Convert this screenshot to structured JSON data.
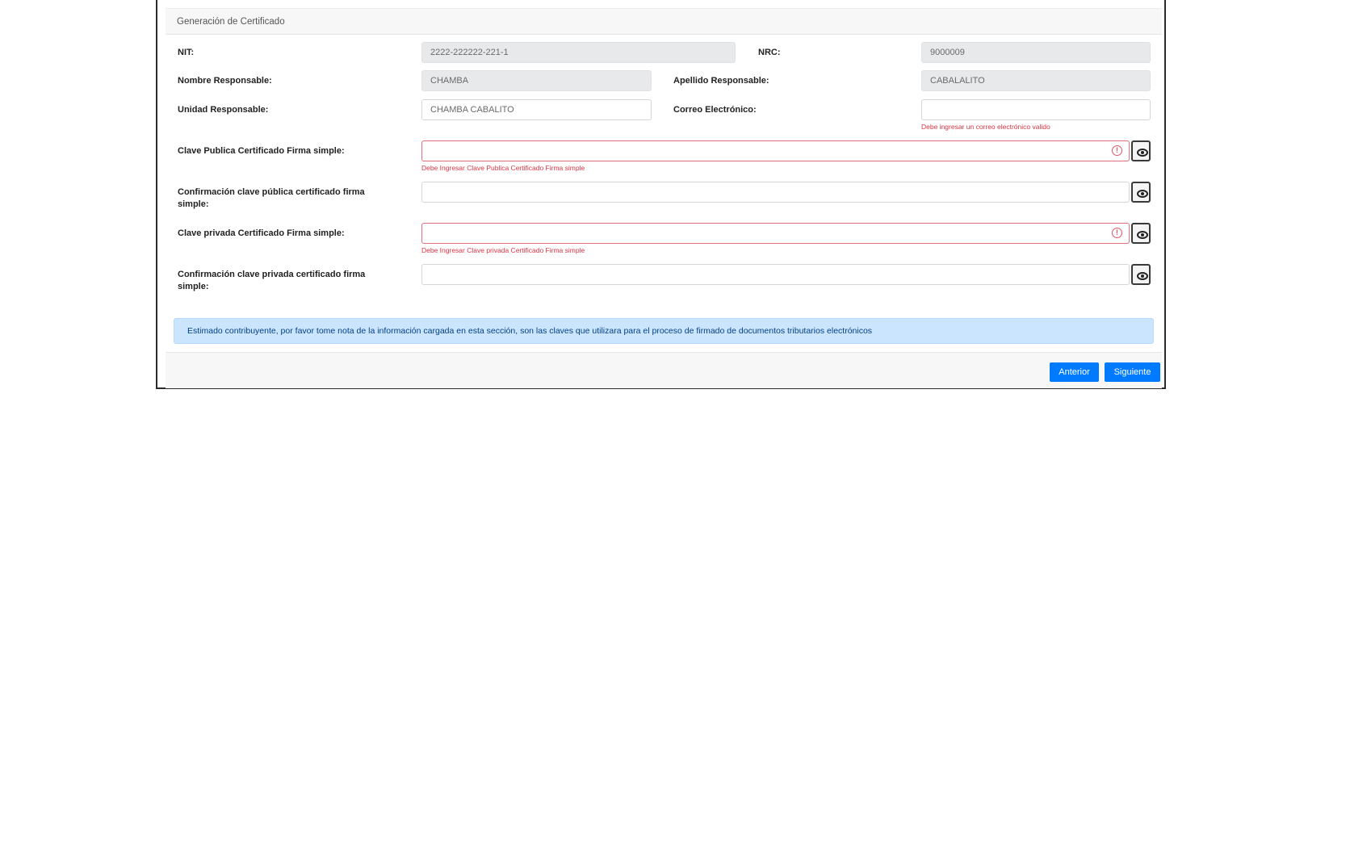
{
  "card": {
    "header_title": "Generación de Certificado"
  },
  "form": {
    "nit": {
      "label": "NIT:",
      "value": "2222-222222-221-1"
    },
    "nrc": {
      "label": "NRC:",
      "value": "9000009"
    },
    "nombre_responsable": {
      "label": "Nombre Responsable:",
      "value": "CHAMBA"
    },
    "apellido_responsable": {
      "label": "Apellido Responsable:",
      "value": "CABALALITO"
    },
    "unidad_responsable": {
      "label": "Unidad Responsable:",
      "value": "CHAMBA CABALITO"
    },
    "correo": {
      "label": "Correo Electrónico:",
      "value": "",
      "error": "Debe ingresar un correo electrónico valido"
    },
    "clave_publica": {
      "label": "Clave Publica Certificado Firma simple:",
      "value": "",
      "error": "Debe Ingresar Clave Publica Certificado Firma simple"
    },
    "confirm_publica": {
      "label": "Confirmación clave pública certificado firma simple:",
      "value": ""
    },
    "clave_privada": {
      "label": "Clave privada Certificado Firma simple:",
      "value": "",
      "error": "Debe Ingresar Clave privada Certificado Firma simple"
    },
    "confirm_privada": {
      "label": "Confirmación clave privada certificado firma simple:",
      "value": ""
    }
  },
  "alert": {
    "text": "Estimado contribuyente, por favor tome nota de la información cargada en esta sección, son las claves que utilizara para el proceso de firmado de documentos tributarios electrónicos"
  },
  "footer": {
    "prev_label": "Anterior",
    "next_label": "Siguiente"
  },
  "icons": {
    "toggle_visibility": "eye-icon",
    "error": "exclamation-circle-icon"
  },
  "colors": {
    "primary": "#007bff",
    "danger": "#dc3545",
    "alert_bg": "#cce5ff",
    "disabled_bg": "#e8e9eb"
  }
}
